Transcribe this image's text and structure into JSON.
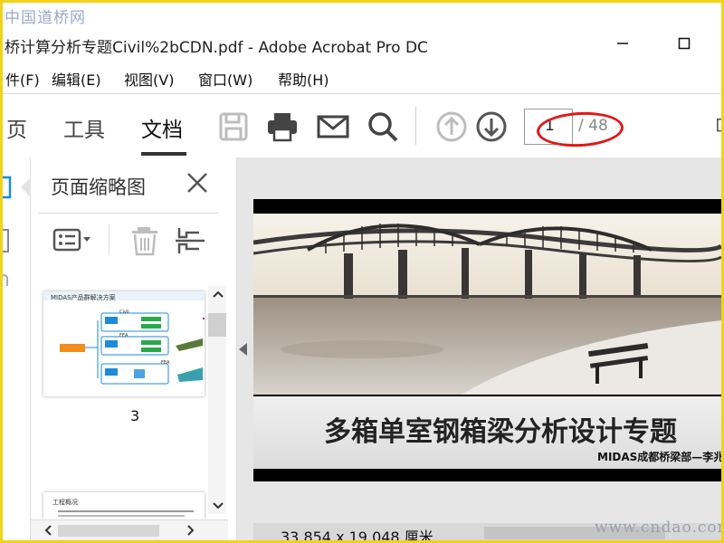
{
  "watermarks": {
    "top": "中国道桥网",
    "bottom": "www.cndao.com"
  },
  "window": {
    "title": "桥计算分析专题Civil%2bCDN.pdf - Adobe Acrobat Pro DC",
    "minimize_icon": "minimize-icon",
    "maximize_icon": "maximize-icon"
  },
  "menu": [
    "件(F)",
    "编辑(E)",
    "视图(V)",
    "窗口(W)",
    "帮助(H)"
  ],
  "tabs": {
    "home": "页",
    "tools": "工具",
    "document": "文档"
  },
  "toolbar_icons": [
    "save-icon",
    "print-icon",
    "mail-icon",
    "search-icon",
    "arrow-up-icon",
    "arrow-down-icon"
  ],
  "page_nav": {
    "current": "1",
    "total": "/ 48"
  },
  "panel": {
    "title": "页面缩略图",
    "thumb1_label": "3",
    "thumb1_text": {
      "heading": "MIDAS产品群解决方案",
      "civil": "Civil",
      "fea": "FEA",
      "fea2": "FEA"
    },
    "thumb2_text": {
      "heading": "工程概况"
    }
  },
  "slide": {
    "title": "多箱单室钢箱梁分析设计专题",
    "subtitle": "MIDAS成都桥梁部—李兆刚"
  },
  "status": {
    "dimensions": "33.854 x 19.048 厘米"
  },
  "colors": {
    "highlight": "#e21818",
    "frame": "#f2d21a",
    "accent_blue": "#1c8ad8"
  }
}
